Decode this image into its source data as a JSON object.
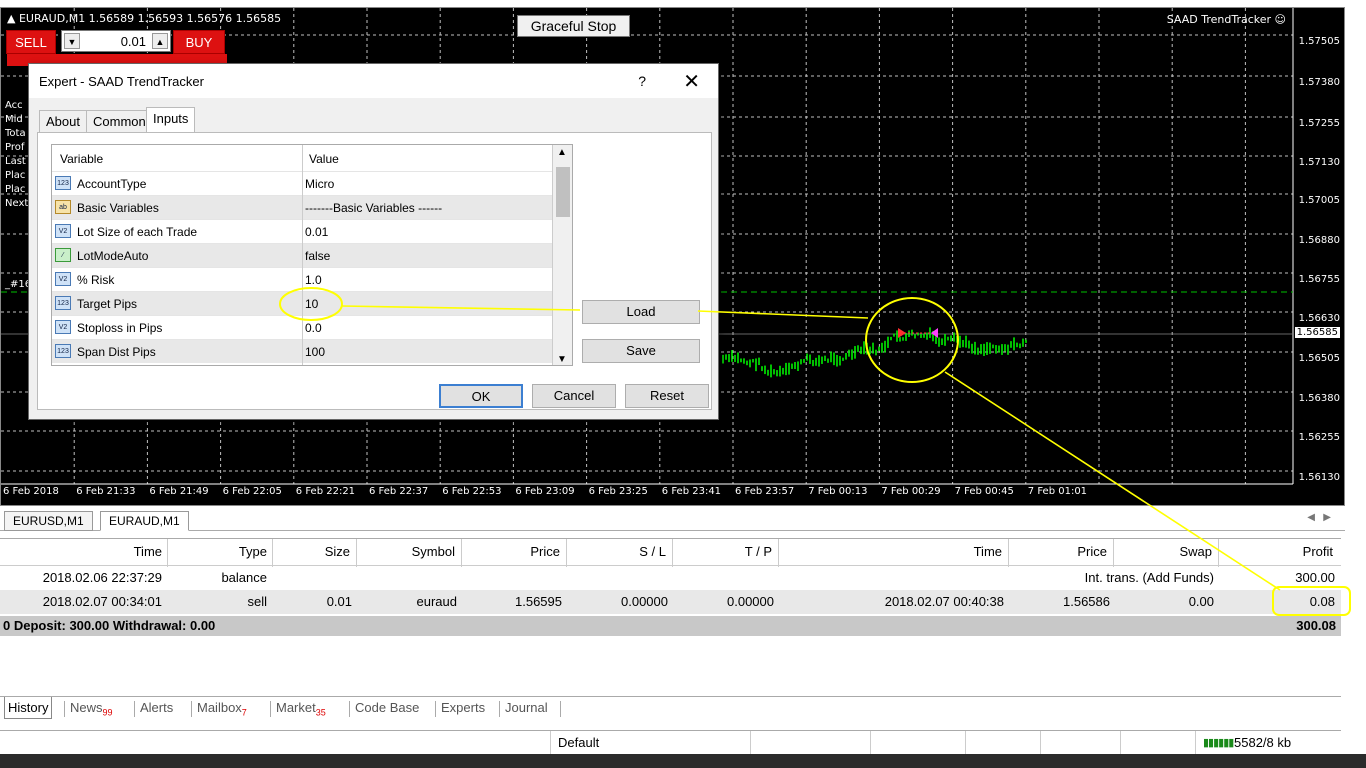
{
  "chart": {
    "title": "▲ EURAUD,M1  1.56589 1.56593 1.56576 1.56585",
    "ea_label": "SAAD TrendTracker ☺",
    "prices": [
      "1.57505",
      "1.57380",
      "1.57255",
      "1.57130",
      "1.57005",
      "1.56880",
      "1.56755",
      "1.56630",
      "1.56585",
      "1.56505",
      "1.56380",
      "1.56255",
      "1.56130"
    ],
    "current_price": "1.56585",
    "times": [
      "6 Feb 2018",
      "6 Feb 21:33",
      "6 Feb 21:49",
      "6 Feb 22:05",
      "6 Feb 22:21",
      "6 Feb 22:37",
      "6 Feb 22:53",
      "6 Feb 23:09",
      "6 Feb 23:25",
      "6 Feb 23:41",
      "6 Feb 23:57",
      "7 Feb 00:13",
      "7 Feb 00:29",
      "7 Feb 00:45",
      "7 Feb 01:01"
    ],
    "left_info": [
      "Acc",
      "Mid",
      "Tota",
      "Prof",
      "Last",
      "Plac",
      "Plac",
      "Next"
    ],
    "order_marker": "_#16",
    "colors": {
      "background": "#000000",
      "candles": "#00ff00",
      "grid": "#c0c0c0",
      "annotation": "#ffff00"
    }
  },
  "one_click": {
    "sell_label": "SELL",
    "buy_label": "BUY",
    "lot": "0.01",
    "down": "▼",
    "up": "▲"
  },
  "graceful_stop": "Graceful Stop",
  "dialog": {
    "title": "Expert - SAAD TrendTracker",
    "help": "?",
    "close": "✕",
    "tabs": [
      "About",
      "Common",
      "Inputs"
    ],
    "columns": [
      "Variable",
      "Value"
    ],
    "rows": [
      {
        "icon": "123",
        "name": "AccountType",
        "value": "Micro"
      },
      {
        "icon": "ab",
        "name": "Basic Variables",
        "value": "-------Basic Variables ------"
      },
      {
        "icon": "V2",
        "name": "Lot Size of each Trade",
        "value": "0.01"
      },
      {
        "icon": "bool",
        "name": "LotModeAuto",
        "value": "false"
      },
      {
        "icon": "V2",
        "name": "% Risk",
        "value": "1.0"
      },
      {
        "icon": "123",
        "name": "Target Pips",
        "value": "10"
      },
      {
        "icon": "V2",
        "name": "Stoploss in Pips",
        "value": "0.0"
      },
      {
        "icon": "123",
        "name": "Span Dist Pips",
        "value": "100"
      }
    ],
    "load": "Load",
    "save": "Save",
    "ok": "OK",
    "cancel": "Cancel",
    "reset": "Reset"
  },
  "chart_tabs": [
    "EURUSD,M1",
    "EURAUD,M1"
  ],
  "history": {
    "columns": [
      "Time",
      "Type",
      "Size",
      "Symbol",
      "Price",
      "S / L",
      "T / P",
      "Time",
      "Price",
      "Swap",
      "Profit"
    ],
    "rows": [
      {
        "time": "2018.02.06 22:37:29",
        "type": "balance",
        "size": "",
        "symbol": "",
        "price": "",
        "sl": "",
        "tp": "",
        "ctime": "",
        "cprice": "Int. trans. (Add Funds)",
        "swap": "",
        "profit": "300.00"
      },
      {
        "time": "2018.02.07 00:34:01",
        "type": "sell",
        "size": "0.01",
        "symbol": "euraud",
        "price": "1.56595",
        "sl": "0.00000",
        "tp": "0.00000",
        "ctime": "2018.02.07 00:40:38",
        "cprice": "1.56586",
        "swap": "0.00",
        "profit": "0.08"
      }
    ],
    "total_left": "0  Deposit: 300.00  Withdrawal: 0.00",
    "total_profit": "300.08"
  },
  "terminal_tabs": [
    {
      "label": "History",
      "badge": ""
    },
    {
      "label": "News",
      "badge": "99"
    },
    {
      "label": "Alerts",
      "badge": ""
    },
    {
      "label": "Mailbox",
      "badge": "7"
    },
    {
      "label": "Market",
      "badge": "35"
    },
    {
      "label": "Code Base",
      "badge": ""
    },
    {
      "label": "Experts",
      "badge": ""
    },
    {
      "label": "Journal",
      "badge": ""
    }
  ],
  "status": {
    "profile": "Default",
    "traffic": "5582/8 kb"
  }
}
